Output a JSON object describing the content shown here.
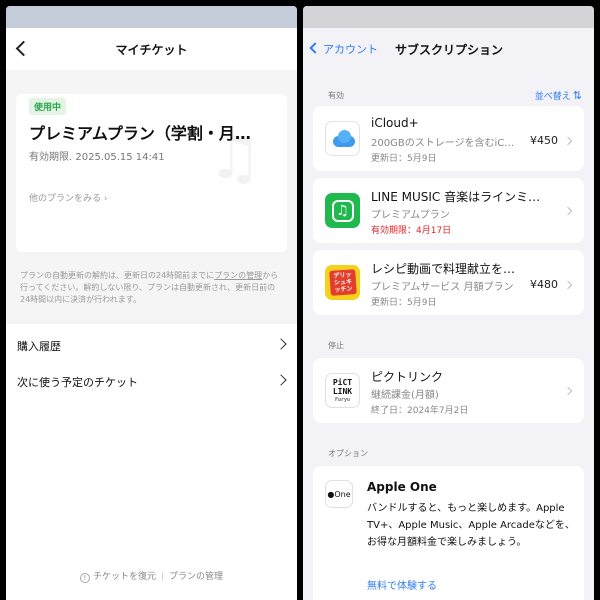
{
  "left": {
    "title": "マイチケット",
    "ticket": {
      "badge": "使用中",
      "plan_name": "プレミアムプラン（学割・月…",
      "validity": "有効期限. 2025.05.15 14:41",
      "other_plans": "他のプランをみる",
      "bg_icon": "♫"
    },
    "note_a": "プランの自動更新の解約は、更新日の24時間前までに",
    "note_link1": "プランの",
    "note_link2": "管理",
    "note_b": "から行ってください。解約しない限り、プランは自動更新され、更新日前の24時間以内に決済が行われます。",
    "menu": [
      {
        "label": "購入履歴"
      },
      {
        "label": "次に使う予定のチケット"
      }
    ],
    "footer": {
      "restore": "チケットを復元",
      "manage": "プランの管理",
      "restore_icon": "!"
    }
  },
  "right": {
    "back_label": "アカウント",
    "title": "サブスクリプション",
    "active_label": "有効",
    "sort_label": "並べ替え",
    "sort_icon": "⇅",
    "stopped_label": "停止",
    "options_label": "オプション",
    "subs": [
      {
        "title": "iCloud+",
        "sub": "200GBのストレージを含むiC…",
        "price": "¥450",
        "date": "更新日：5月9日",
        "icon": "icloud-icon"
      },
      {
        "title": "LINE MUSIC 音楽はラインミ…",
        "sub": "プレミアムプラン",
        "price": "",
        "date": "有効期限：4月17日",
        "icon": "line-music-icon",
        "date_color": "#e3262b"
      },
      {
        "title": "レシピ動画で料理献立を…",
        "sub": "プレミアムサービス 月額プラン",
        "price": "¥480",
        "date": "更新日：5月9日",
        "icon": "delish-kitchen-icon",
        "icon_text": "デリッシュキッチン"
      }
    ],
    "stopped": [
      {
        "title": "ピクトリンク",
        "sub": "継続課金(月額)",
        "date": "終了日：2024年7月2日",
        "icon": "pictlink-icon",
        "icon_line1": "PiCT",
        "icon_line2": "LINK",
        "icon_line3": "Furyu"
      }
    ],
    "apple_one": {
      "icon_text": "One",
      "title": "Apple One",
      "body": "バンドルすると、もっと楽しめます。Apple TV+、Apple Music、Apple Arcadeなどを、お得な月額料金で楽しみましょう。",
      "link": "無料で体験する"
    }
  }
}
